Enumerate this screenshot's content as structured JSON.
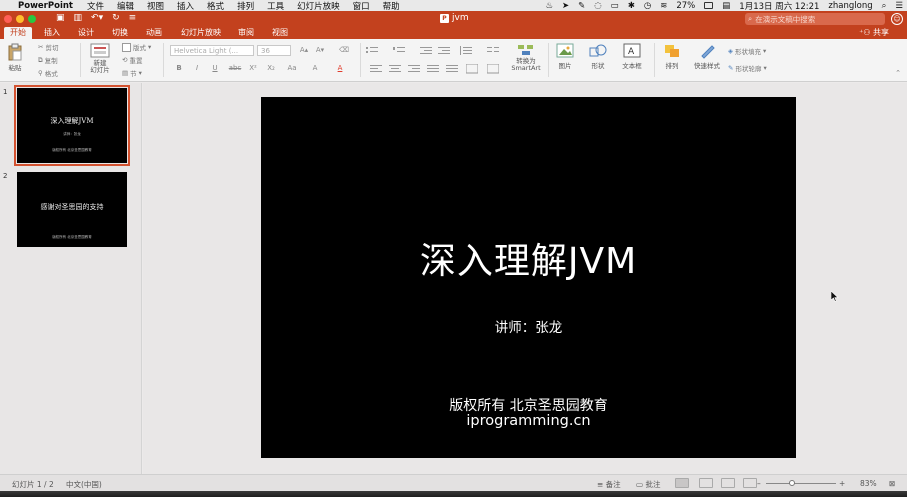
{
  "menubar": {
    "app_name": "PowerPoint",
    "items": [
      "文件",
      "编辑",
      "视图",
      "插入",
      "格式",
      "排列",
      "工具",
      "幻灯片放映",
      "窗口",
      "帮助"
    ],
    "battery": "27%",
    "datetime": "1月13日 周六  12:21",
    "user": "zhanglong"
  },
  "titlebar": {
    "doc_title": "jvm",
    "search_placeholder": "在演示文稿中搜索"
  },
  "ribbon": {
    "tabs": [
      "开始",
      "插入",
      "设计",
      "切换",
      "动画",
      "幻灯片放映",
      "审阅",
      "视图"
    ],
    "active_tab": "开始",
    "share_label": "共享",
    "paste_label": "粘贴",
    "cut_label": "剪切",
    "copy_label": "复制",
    "format_label": "格式",
    "new_slide_label": "新建\n幻灯片",
    "layout_label": "版式",
    "reset_label": "重置",
    "section_label": "节",
    "font_name": "Helvetica Light (...",
    "font_size": "36",
    "convert_smartart_label": "转换为\nSmartArt",
    "picture_label": "图片",
    "shape_label": "形状",
    "textbox_label": "文本框",
    "arrange_label": "排列",
    "quick_styles_label": "快速样式",
    "shape_fill_label": "形状填充",
    "shape_outline_label": "形状轮廓"
  },
  "thumbnails": [
    {
      "number": "1",
      "title": "深入理解JVM",
      "sub": "讲师：张龙",
      "footer": "版权所有  北京圣思园教育"
    },
    {
      "number": "2",
      "title": "感谢对圣思园的支持",
      "sub": "",
      "footer": "版权所有  北京圣思园教育"
    }
  ],
  "slide": {
    "title": "深入理解JVM",
    "subtitle": "讲师：张龙",
    "copyright": "版权所有  北京圣思园教育",
    "url": "iprogramming.cn"
  },
  "statusbar": {
    "slide_counter": "幻灯片 1 / 2",
    "language": "中文(中国)",
    "notes_label": "备注",
    "comments_label": "批注",
    "zoom": "83%"
  },
  "colors": {
    "accent": "#c3411e",
    "slide_bg": "#000000",
    "thumb_selected": "#d35230"
  }
}
